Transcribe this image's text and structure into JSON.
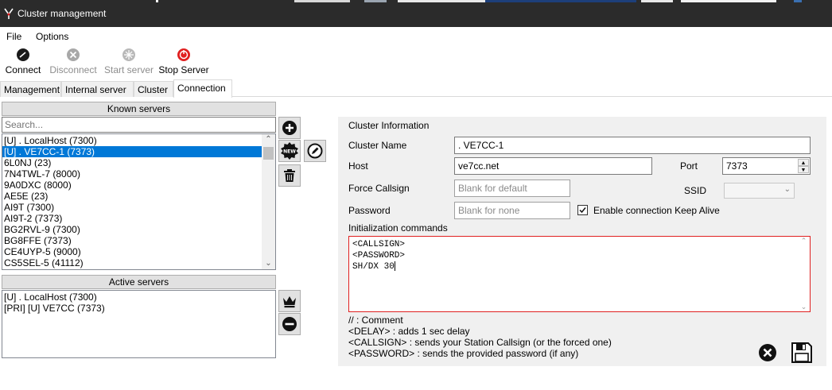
{
  "window": {
    "title": "Cluster management"
  },
  "menu": {
    "file": "File",
    "options": "Options"
  },
  "toolbar": {
    "connect": "Connect",
    "disconnect": "Disconnect",
    "start_server": "Start server",
    "stop_server": "Stop Server"
  },
  "tabs": [
    {
      "label": "Management"
    },
    {
      "label": "Internal server"
    },
    {
      "label": "Cluster"
    },
    {
      "label": "Connection"
    }
  ],
  "known_servers": {
    "header": "Known servers",
    "search_placeholder": "Search...",
    "items": [
      {
        "label": "[U] . LocalHost (7300)"
      },
      {
        "label": "[U] . VE7CC-1 (7373)"
      },
      {
        "label": "6L0NJ (23)"
      },
      {
        "label": "7N4TWL-7 (8000)"
      },
      {
        "label": "9A0DXC (8000)"
      },
      {
        "label": "AE5E (23)"
      },
      {
        "label": "AI9T (7300)"
      },
      {
        "label": "AI9T-2 (7373)"
      },
      {
        "label": "BG2RVL-9 (7300)"
      },
      {
        "label": "BG8FFE (7373)"
      },
      {
        "label": "CE4UYP-5 (9000)"
      },
      {
        "label": "CS5SEL-5 (41112)"
      }
    ]
  },
  "active_servers": {
    "header": "Active servers",
    "items": [
      {
        "label": "[U] . LocalHost (7300)"
      },
      {
        "label": "[PRI] [U] VE7CC (7373)"
      }
    ]
  },
  "cluster_info": {
    "group_title": "Cluster Information",
    "name_label": "Cluster Name",
    "name_value": ". VE7CC-1",
    "host_label": "Host",
    "host_value": "ve7cc.net",
    "port_label": "Port",
    "port_value": "7373",
    "force_callsign_label": "Force Callsign",
    "force_callsign_placeholder": "Blank for default",
    "ssid_label": "SSID",
    "password_label": "Password",
    "password_placeholder": "Blank for none",
    "keepalive_label": "Enable connection Keep Alive",
    "keepalive_checked": true,
    "init_label": "Initialization commands",
    "init_lines": [
      "<CALLSIGN>",
      "<PASSWORD>",
      "SH/DX 30"
    ],
    "help_lines": [
      "// : Comment",
      "<DELAY> : adds 1 sec delay",
      "<CALLSIGN> : sends your Station Callsign (or the forced one)",
      "<PASSWORD> : sends the provided password (if any)"
    ]
  },
  "icons": {
    "add": "plus-circle-icon",
    "new": "new-badge-icon",
    "edit": "pencil-circle-icon",
    "delete": "trash-icon",
    "primary": "crown-icon",
    "remove": "minus-circle-icon",
    "cancel": "x-circle-icon",
    "save": "floppy-disk-icon"
  },
  "colors": {
    "selection": "#0078d7",
    "stop_server": "#e02020",
    "init_border": "#e02020"
  }
}
